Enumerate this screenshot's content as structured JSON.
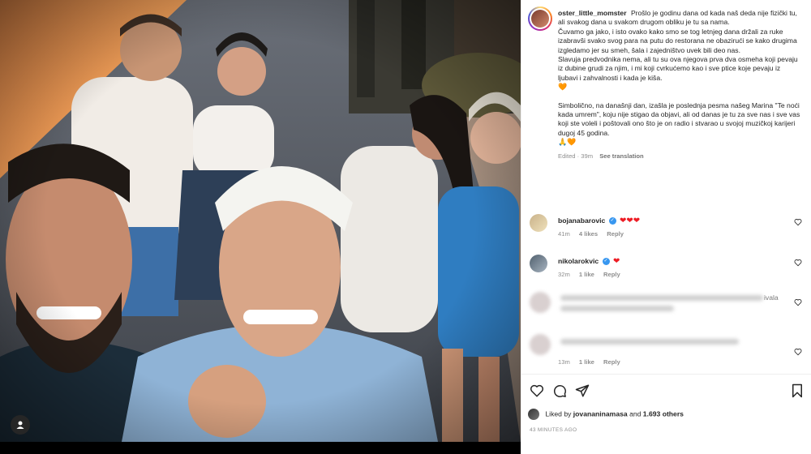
{
  "post": {
    "username": "oster_little_momster",
    "caption_paragraphs": [
      "Prošlo je godinu dana od kada naš deda nije fizički tu, ali svakog dana u svakom drugom obliku je tu sa nama.",
      "Čuvamo ga jako, i isto ovako kako smo se tog letnjeg dana držali za ruke izabravši svako svog para na putu do restorana ne obazirući se kako drugima izgledamo jer su smeh, šala i zajedništvo uvek bili deo nas.",
      "Slavuja predvodnika nema, ali tu su ova njegova prva dva osmeha koji pevaju iz dubine grudi za njim, i mi koji cvrkućemo kao i sve ptice koje pevaju iz ljubavi i zahvalnosti i kada je kiša.",
      "🧡",
      "Simbolično, na današnji dan, izašla je poslednja pesma našeg Marina \"Te noći kada umrem\", koju nije stigao da objavi, ali od danas je tu za sve nas i sve vas koji ste voleli i poštovali ono što je on radio i stvarao u svojoj muzičkoj karijeri dugoj 45 godina.",
      "🙏🧡"
    ],
    "edited_label": "Edited · 39m",
    "see_translation": "See translation",
    "liked_by_prefix": "Liked by",
    "liked_by_user": "jovananinamasa",
    "liked_by_and": "and",
    "liked_by_others": "1.693 others",
    "timestamp": "43 MINUTES AGO"
  },
  "comments": [
    {
      "username": "bojanabarovic",
      "verified": true,
      "text": "❤❤❤",
      "time": "41m",
      "likes": "4 likes",
      "reply": "Reply"
    },
    {
      "username": "nikolarokvic",
      "verified": true,
      "text": "❤",
      "time": "32m",
      "likes": "1 like",
      "reply": "Reply"
    },
    {
      "fragment": "ivala"
    },
    {
      "time": "13m",
      "likes": "1 like",
      "reply": "Reply"
    }
  ],
  "icons": {
    "like": "heart-outline-icon",
    "comment": "comment-bubble-icon",
    "share": "paper-plane-icon",
    "save": "bookmark-icon",
    "tag": "user-tag-icon"
  },
  "colors": {
    "verified": "#3897f0",
    "heart": "#ed1c24",
    "secondary_text": "#8e8e8e"
  }
}
